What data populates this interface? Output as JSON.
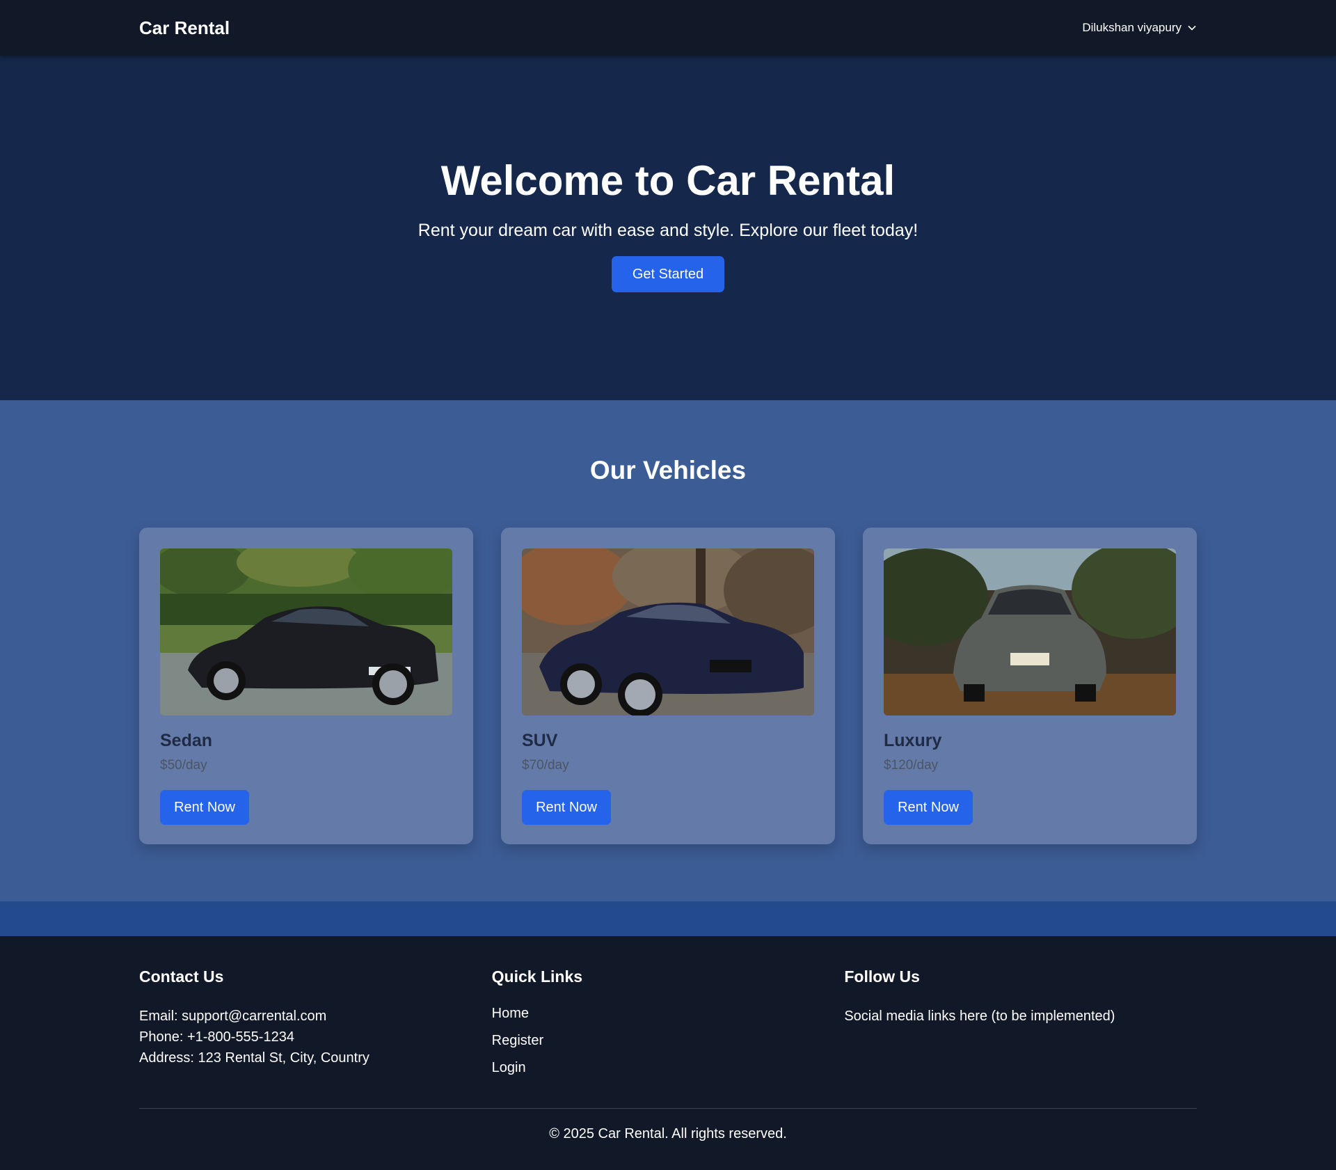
{
  "navbar": {
    "brand": "Car Rental",
    "user_name": "Dilukshan viyapury",
    "user_menu_icon": "chevron-down-icon"
  },
  "hero": {
    "title": "Welcome to Car Rental",
    "subtitle": "Rent your dream car with ease and style. Explore our fleet today!",
    "cta_label": "Get Started"
  },
  "vehicles": {
    "heading": "Our Vehicles",
    "items": [
      {
        "name": "Sedan",
        "price": "$50/day",
        "button": "Rent Now",
        "image": "black-sedan-car-photo"
      },
      {
        "name": "SUV",
        "price": "$70/day",
        "button": "Rent Now",
        "image": "dark-blue-coupe-car-photo"
      },
      {
        "name": "Luxury",
        "price": "$120/day",
        "button": "Rent Now",
        "image": "silver-sedan-car-photo"
      }
    ]
  },
  "footer": {
    "contact": {
      "heading": "Contact Us",
      "email": "Email: support@carrental.com",
      "phone": "Phone: +1-800-555-1234",
      "address": "Address: 123 Rental St, City, Country"
    },
    "quick_links": {
      "heading": "Quick Links",
      "links": [
        "Home",
        "Register",
        "Login"
      ]
    },
    "follow": {
      "heading": "Follow Us",
      "text": "Social media links here (to be implemented)"
    },
    "copyright": "© 2025 Car Rental. All rights reserved."
  },
  "colors": {
    "navbar_bg": "#111827",
    "hero_bg": "#15284b",
    "section_bg": "#3c5c95",
    "card_bg": "#647ba9",
    "accent": "#2563eb"
  }
}
